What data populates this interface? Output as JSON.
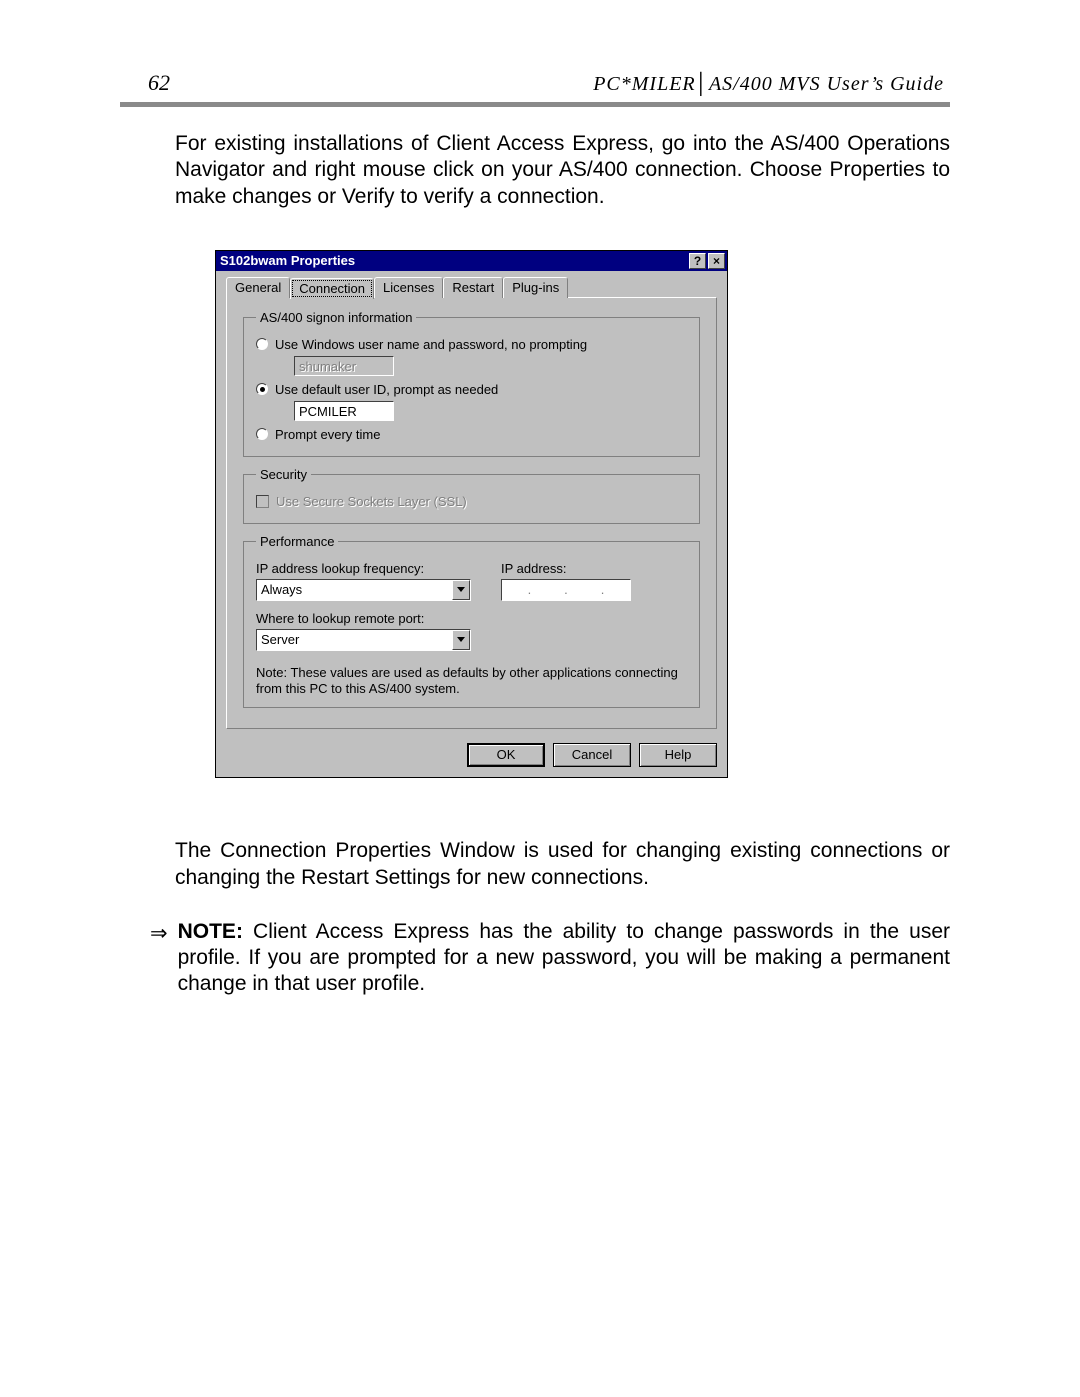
{
  "header": {
    "page_number": "62",
    "guide_title": "PC*MILER│AS/400 MVS User’s Guide"
  },
  "para1": "For existing installations of Client Access Express, go into the AS/400 Operations Navigator and right mouse click on your AS/400 connection. Choose Properties to make changes or Verify to verify a connection.",
  "para2": "The Connection Properties Window is used for changing existing connections or changing the Restart Settings for new connections.",
  "note": {
    "arrow": "⇒",
    "label": "NOTE:",
    "text": "  Client Access Express has the ability to change passwords in the user profile.  If you are prompted for a new password, you will be making a permanent change in that user profile."
  },
  "dialog": {
    "title": "S102bwam Properties",
    "help_glyph": "?",
    "close_glyph": "×",
    "tabs": [
      "General",
      "Connection",
      "Licenses",
      "Restart",
      "Plug-ins"
    ],
    "active_tab": "Connection",
    "signon": {
      "legend": "AS/400 signon information",
      "opt_windows": "Use Windows user name and password, no prompting",
      "windows_value": "shumaker",
      "opt_default": "Use default user ID, prompt as needed",
      "default_value": "PCMILER",
      "opt_prompt": "Prompt every time"
    },
    "security": {
      "legend": "Security",
      "ssl_label": "Use Secure Sockets Layer (SSL)"
    },
    "performance": {
      "legend": "Performance",
      "ip_lookup_label": "IP address lookup frequency:",
      "ip_lookup_value": "Always",
      "ip_address_label": "IP address:",
      "ip_dots": ".",
      "remote_port_label": "Where to lookup remote port:",
      "remote_port_value": "Server",
      "note": "Note: These values are used as defaults by other applications connecting from this PC to this AS/400 system."
    },
    "buttons": {
      "ok": "OK",
      "cancel": "Cancel",
      "help": "Help"
    }
  }
}
